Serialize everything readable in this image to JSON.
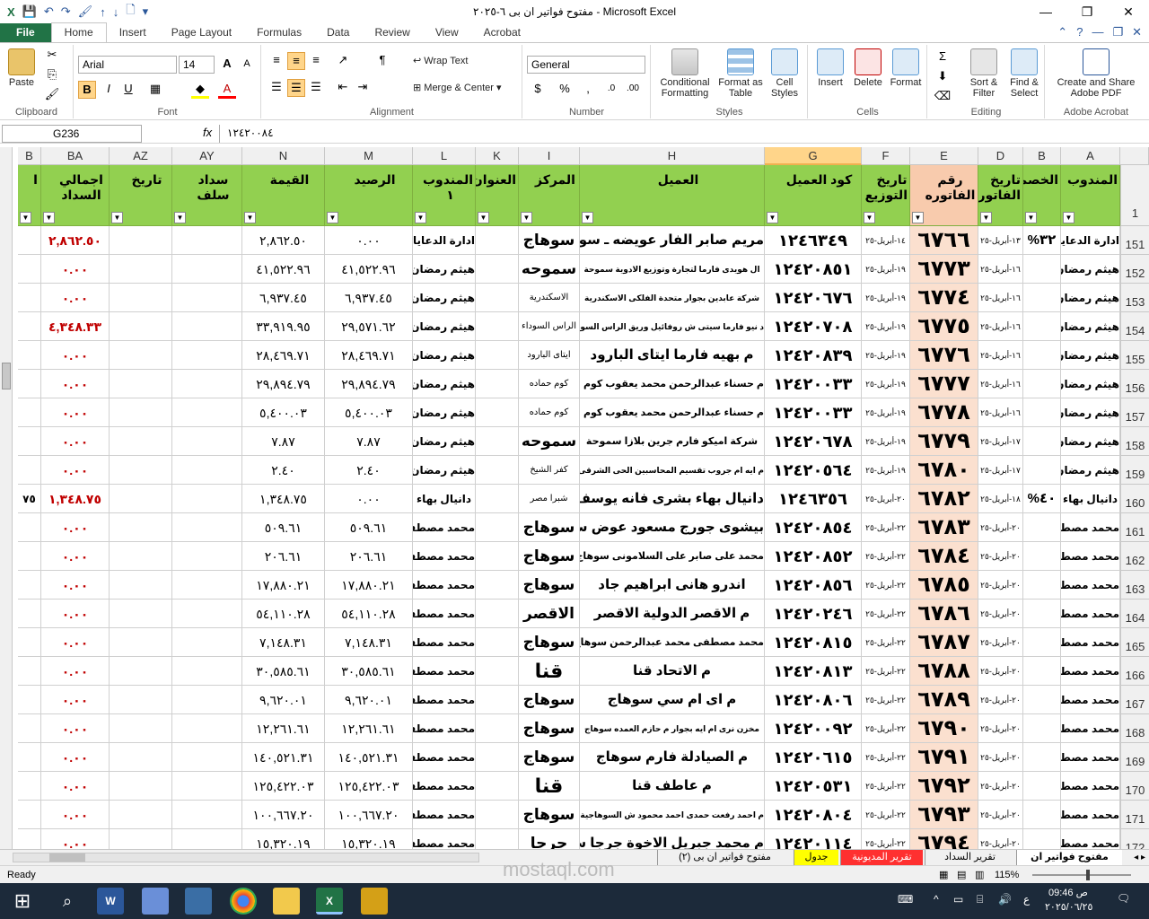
{
  "window": {
    "title": "مفتوح فواتير ان بى ٦-٢٠٢٥ - Microsoft Excel"
  },
  "tabs": [
    "File",
    "Home",
    "Insert",
    "Page Layout",
    "Formulas",
    "Data",
    "Review",
    "View",
    "Acrobat"
  ],
  "ribbon": {
    "clipboard": {
      "label": "Clipboard",
      "paste": "Paste"
    },
    "font": {
      "label": "Font",
      "name": "Arial",
      "size": "14"
    },
    "alignment": {
      "label": "Alignment",
      "wrap": "Wrap Text",
      "merge": "Merge & Center"
    },
    "number": {
      "label": "Number",
      "format": "General"
    },
    "styles": {
      "label": "Styles",
      "cond": "Conditional Formatting",
      "table": "Format as Table",
      "cell": "Cell Styles"
    },
    "cells": {
      "label": "Cells",
      "insert": "Insert",
      "delete": "Delete",
      "format": "Format"
    },
    "editing": {
      "label": "Editing",
      "sort": "Sort & Filter",
      "find": "Find & Select"
    },
    "acrobat": {
      "label": "Adobe Acrobat",
      "create": "Create and Share Adobe PDF"
    }
  },
  "formula_bar": {
    "name_box": "G236",
    "fx": "fx",
    "value": "١٢٤٢٠٠٨٤"
  },
  "columns": {
    "letters": [
      "A",
      "B",
      "D",
      "E",
      "F",
      "G",
      "H",
      "I",
      "K",
      "L",
      "M",
      "N",
      "AY",
      "AZ",
      "BA",
      "B"
    ],
    "headers": [
      "المندوب",
      "الخصم",
      "تاريخ الفاتورة",
      "رقم الفاتوره",
      "تاريخ التوزيع",
      "كود العميل",
      "العميل",
      "المركز",
      "العنوان",
      "المندوب ١",
      "الرصيد",
      "القيمة",
      "سداد سلف",
      "تاريخ",
      "اجمالي السداد",
      "ا"
    ],
    "header_row": "1"
  },
  "rows": [
    {
      "n": "151",
      "a": "ادارة الدعايا",
      "b": "٣٢%",
      "d": "١٣-أبريل-٢٥",
      "e": "٦٧٦٦",
      "f": "١٤-أبريل-٢٥",
      "g": "١٢٤٦٣٤٩",
      "h": "مريم صابر الفار عويضه ـ سوهاج",
      "i": "سوهاج",
      "l": "ادارة الدعايا",
      "m": "٠.٠٠",
      "nv": "٢,٨٦٢.٥٠",
      "ba": "٢,٨٦٢.٥٠",
      "x": ""
    },
    {
      "n": "152",
      "a": "هيثم رمضان",
      "b": "",
      "d": "١٦-أبريل-٢٥",
      "e": "٦٧٧٣",
      "f": "١٩-أبريل-٢٥",
      "g": "١٢٤٢٠٨٥١",
      "h": "ال هويدى فارما لتجارة وتوزيع الادوية سموحة",
      "i": "سموحه",
      "l": "هيثم رمضان",
      "m": "٤١,٥٢٢.٩٦",
      "nv": "٤١,٥٢٢.٩٦",
      "ba": "٠.٠٠",
      "x": ""
    },
    {
      "n": "153",
      "a": "هيثم رمضان",
      "b": "",
      "d": "١٦-أبريل-٢٥",
      "e": "٦٧٧٤",
      "f": "١٩-أبريل-٢٥",
      "g": "١٢٤٢٠٦٧٦",
      "h": "شركة عابدين بجوار متحدة الفلكى الاسكندرية",
      "i": "الاسكندرية",
      "l": "هيثم رمضان",
      "m": "٦,٩٣٧.٤٥",
      "nv": "٦,٩٣٧.٤٥",
      "ba": "٠.٠٠",
      "x": ""
    },
    {
      "n": "154",
      "a": "هيثم رمضان",
      "b": "",
      "d": "١٦-أبريل-٢٥",
      "e": "٦٧٧٥",
      "f": "١٩-أبريل-٢٥",
      "g": "١٢٤٢٠٧٠٨",
      "h": "د نيو فارما سيتى ش روفائيل وريق الراس السوداء الاسكندرية",
      "i": "الراس السوداء",
      "l": "هيثم رمضان",
      "m": "٢٩,٥٧١.٦٢",
      "nv": "٣٣,٩١٩.٩٥",
      "ba": "٤,٣٤٨.٣٣",
      "x": ""
    },
    {
      "n": "155",
      "a": "هيثم رمضان",
      "b": "",
      "d": "١٦-أبريل-٢٥",
      "e": "٦٧٧٦",
      "f": "١٩-أبريل-٢٥",
      "g": "١٢٤٢٠٨٣٩",
      "h": "م بهيه فارما ايتاى البارود",
      "i": "ايتاى البارود",
      "l": "هيثم رمضان",
      "m": "٢٨,٤٦٩.٧١",
      "nv": "٢٨,٤٦٩.٧١",
      "ba": "٠.٠٠",
      "x": ""
    },
    {
      "n": "156",
      "a": "هيثم رمضان",
      "b": "",
      "d": "١٦-أبريل-٢٥",
      "e": "٦٧٧٧",
      "f": "١٩-أبريل-٢٥",
      "g": "١٢٤٢٠٠٣٣",
      "h": "م حسناء عبدالرحمن محمد يعقوب كوم حمادة",
      "i": "كوم حماده",
      "l": "هيثم رمضان",
      "m": "٢٩,٨٩٤.٧٩",
      "nv": "٢٩,٨٩٤.٧٩",
      "ba": "٠.٠٠",
      "x": ""
    },
    {
      "n": "157",
      "a": "هيثم رمضان",
      "b": "",
      "d": "١٦-أبريل-٢٥",
      "e": "٦٧٧٨",
      "f": "١٩-أبريل-٢٥",
      "g": "١٢٤٢٠٠٣٣",
      "h": "م حسناء عبدالرحمن محمد يعقوب كوم حمادة",
      "i": "كوم حماده",
      "l": "هيثم رمضان",
      "m": "٥,٤٠٠.٠٣",
      "nv": "٥,٤٠٠.٠٣",
      "ba": "٠.٠٠",
      "x": ""
    },
    {
      "n": "158",
      "a": "هيثم رمضان",
      "b": "",
      "d": "١٧-أبريل-٢٥",
      "e": "٦٧٧٩",
      "f": "١٩-أبريل-٢٥",
      "g": "١٢٤٢٠٦٧٨",
      "h": "شركة اميكو فارم جرين بلازا سموحة",
      "i": "سموحه",
      "l": "هيثم رمضان",
      "m": "٧.٨٧",
      "nv": "٧.٨٧",
      "ba": "٠.٠٠",
      "x": ""
    },
    {
      "n": "159",
      "a": "هيثم رمضان",
      "b": "",
      "d": "١٧-أبريل-٢٥",
      "e": "٦٧٨٠",
      "f": "١٩-أبريل-٢٥",
      "g": "١٢٤٢٠٥٦٤",
      "h": "م ايه ام جروب تقسيم المحاسبين الحى الشرقى",
      "i": "كفر الشيخ",
      "l": "هيثم رمضان",
      "m": "٢.٤٠",
      "nv": "٢.٤٠",
      "ba": "٠.٠٠",
      "x": ""
    },
    {
      "n": "160",
      "a": "دانيال بهاء",
      "b": "٤٠%",
      "d": "١٨-أبريل-٢٥",
      "e": "٦٧٨٢",
      "f": "٢٠-أبريل-٢٥",
      "g": "١٢٤٦٣٥٦",
      "h": "دانيال بهاء بشرى فانه يوسف",
      "i": "شبرا مصر",
      "l": "دانيال بهاء",
      "m": "٠.٠٠",
      "nv": "١,٣٤٨.٧٥",
      "ba": "١,٣٤٨.٧٥",
      "x": "٧٥"
    },
    {
      "n": "161",
      "a": "محمد مصطفى",
      "b": "",
      "d": "٢٠-أبريل-٢٥",
      "e": "٦٧٨٣",
      "f": "٢٢-أبريل-٢٥",
      "g": "١٢٤٢٠٨٥٤",
      "h": "بيشوى جورج مسعود عوض سوهاج",
      "i": "سوهاج",
      "l": "محمد مصطفى",
      "m": "٥٠٩.٦١",
      "nv": "٥٠٩.٦١",
      "ba": "٠.٠٠",
      "x": ""
    },
    {
      "n": "162",
      "a": "محمد مصطفى",
      "b": "",
      "d": "٢٠-أبريل-٢٥",
      "e": "٦٧٨٤",
      "f": "٢٢-أبريل-٢٥",
      "g": "١٢٤٢٠٨٥٢",
      "h": "محمد على صابر على السلامونى سوهاج",
      "i": "سوهاج",
      "l": "محمد مصطفى",
      "m": "٢٠٦.٦١",
      "nv": "٢٠٦.٦١",
      "ba": "٠.٠٠",
      "x": ""
    },
    {
      "n": "163",
      "a": "محمد مصطفى",
      "b": "",
      "d": "٢٠-أبريل-٢٥",
      "e": "٦٧٨٥",
      "f": "٢٢-أبريل-٢٥",
      "g": "١٢٤٢٠٨٥٦",
      "h": "اندرو هانى ابراهيم جاد",
      "i": "سوهاج",
      "l": "محمد مصطفى",
      "m": "١٧,٨٨٠.٢١",
      "nv": "١٧,٨٨٠.٢١",
      "ba": "٠.٠٠",
      "x": ""
    },
    {
      "n": "164",
      "a": "محمد مصطفى",
      "b": "",
      "d": "٢٠-أبريل-٢٥",
      "e": "٦٧٨٦",
      "f": "٢٢-أبريل-٢٥",
      "g": "١٢٤٢٠٢٤٦",
      "h": "م الاقصر الدولية الاقصر",
      "i": "الاقصر",
      "l": "محمد مصطفى",
      "m": "٥٤,١١٠.٢٨",
      "nv": "٥٤,١١٠.٢٨",
      "ba": "٠.٠٠",
      "x": ""
    },
    {
      "n": "165",
      "a": "محمد مصطفى",
      "b": "",
      "d": "٢٠-أبريل-٢٥",
      "e": "٦٧٨٧",
      "f": "٢٢-أبريل-٢٥",
      "g": "١٢٤٢٠٨١٥",
      "h": "محمد مصطفى محمد عبدالرحمن سوهاج",
      "i": "سوهاج",
      "l": "محمد مصطفى",
      "m": "٧,١٤٨.٣١",
      "nv": "٧,١٤٨.٣١",
      "ba": "٠.٠٠",
      "x": ""
    },
    {
      "n": "166",
      "a": "محمد مصطفى",
      "b": "",
      "d": "٢٠-أبريل-٢٥",
      "e": "٦٧٨٨",
      "f": "٢٢-أبريل-٢٥",
      "g": "١٢٤٢٠٨١٣",
      "h": "م الاتحاد قنا",
      "i": "قنا",
      "l": "محمد مصطفى",
      "m": "٣٠,٥٨٥.٦١",
      "nv": "٣٠,٥٨٥.٦١",
      "ba": "٠.٠٠",
      "x": ""
    },
    {
      "n": "167",
      "a": "محمد مصطفى",
      "b": "",
      "d": "٢٠-أبريل-٢٥",
      "e": "٦٧٨٩",
      "f": "٢٢-أبريل-٢٥",
      "g": "١٢٤٢٠٨٠٦",
      "h": "م اى ام سي سوهاج",
      "i": "سوهاج",
      "l": "محمد مصطفى",
      "m": "٩,٦٢٠.٠١",
      "nv": "٩,٦٢٠.٠١",
      "ba": "٠.٠٠",
      "x": ""
    },
    {
      "n": "168",
      "a": "محمد مصطفى",
      "b": "",
      "d": "٢٠-أبريل-٢٥",
      "e": "٦٧٩٠",
      "f": "٢٢-أبريل-٢٥",
      "g": "١٢٤٢٠٠٩٢",
      "h": "مخزن نرى ام ايه بجوار م حازم العمده سوهاج",
      "i": "سوهاج",
      "l": "محمد مصطفى",
      "m": "١٢,٢٦١.٦١",
      "nv": "١٢,٢٦١.٦١",
      "ba": "٠.٠٠",
      "x": ""
    },
    {
      "n": "169",
      "a": "محمد مصطفى",
      "b": "",
      "d": "٢٠-أبريل-٢٥",
      "e": "٦٧٩١",
      "f": "٢٢-أبريل-٢٥",
      "g": "١٢٤٢٠٦١٥",
      "h": "م الصيادلة فارم سوهاج",
      "i": "سوهاج",
      "l": "محمد مصطفى",
      "m": "١٤٠,٥٢١.٣١",
      "nv": "١٤٠,٥٢١.٣١",
      "ba": "٠.٠٠",
      "x": ""
    },
    {
      "n": "170",
      "a": "محمد مصطفى",
      "b": "",
      "d": "٢٠-أبريل-٢٥",
      "e": "٦٧٩٢",
      "f": "٢٢-أبريل-٢٥",
      "g": "١٢٤٢٠٥٣١",
      "h": "م عاطف قنا",
      "i": "قنا",
      "l": "محمد مصطفى",
      "m": "١٢٥,٤٢٢.٠٣",
      "nv": "١٢٥,٤٢٢.٠٣",
      "ba": "٠.٠٠",
      "x": ""
    },
    {
      "n": "171",
      "a": "محمد مصطفى",
      "b": "",
      "d": "٢٠-أبريل-٢٥",
      "e": "٦٧٩٣",
      "f": "٢٢-أبريل-٢٥",
      "g": "١٢٤٢٠٨٠٤",
      "h": "م احمد رفعت حمدى احمد محمود ش السوهاجية سوهاج",
      "i": "سوهاج",
      "l": "محمد مصطفى",
      "m": "١٠٠,٦٦٧.٢٠",
      "nv": "١٠٠,٦٦٧.٢٠",
      "ba": "٠.٠٠",
      "x": ""
    },
    {
      "n": "172",
      "a": "محمد مصطفى",
      "b": "",
      "d": "٢٠-أبريل-٢٥",
      "e": "٦٧٩٤",
      "f": "٢٢-أبريل-٢٥",
      "g": "١٢٤٢٠١١٤",
      "h": "م محمد جبريل الاخوة جرجا سوهاج",
      "i": "جرجا",
      "l": "محمد مصطفى",
      "m": "١٥,٣٢٠.١٩",
      "nv": "١٥,٣٢٠.١٩",
      "ba": "٠.٠٠",
      "x": ""
    }
  ],
  "sheet_tabs": [
    "مفتوح فواتير ان بى",
    "تقرير السداد",
    "تقرير المديونية",
    "جدول",
    "مفتوح فواتير ان بى (٢)"
  ],
  "status": {
    "ready": "Ready",
    "zoom": "115%"
  },
  "taskbar": {
    "time": "09:46 ص",
    "date": "٢٠٢٥/٠٦/٢٥",
    "lang": "ع"
  },
  "watermark": "mostaql.com",
  "colors": {
    "header_green": "#92d050",
    "invoice_orange": "#f8cbad",
    "accent": "#217346"
  }
}
